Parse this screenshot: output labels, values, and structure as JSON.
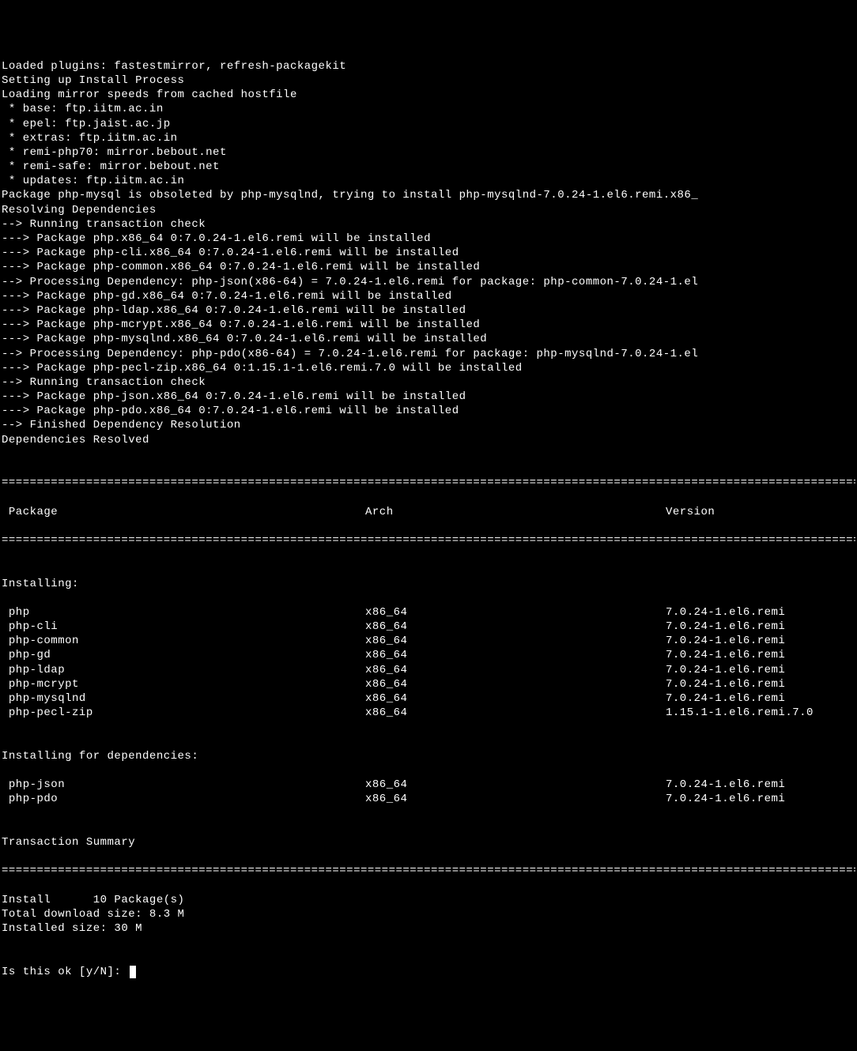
{
  "preamble": [
    "Loaded plugins: fastestmirror, refresh-packagekit",
    "Setting up Install Process",
    "Loading mirror speeds from cached hostfile",
    " * base: ftp.iitm.ac.in",
    " * epel: ftp.jaist.ac.jp",
    " * extras: ftp.iitm.ac.in",
    " * remi-php70: mirror.bebout.net",
    " * remi-safe: mirror.bebout.net",
    " * updates: ftp.iitm.ac.in",
    "Package php-mysql is obsoleted by php-mysqlnd, trying to install php-mysqlnd-7.0.24-1.el6.remi.x86_",
    "Resolving Dependencies",
    "--> Running transaction check",
    "---> Package php.x86_64 0:7.0.24-1.el6.remi will be installed",
    "---> Package php-cli.x86_64 0:7.0.24-1.el6.remi will be installed",
    "---> Package php-common.x86_64 0:7.0.24-1.el6.remi will be installed",
    "--> Processing Dependency: php-json(x86-64) = 7.0.24-1.el6.remi for package: php-common-7.0.24-1.el",
    "---> Package php-gd.x86_64 0:7.0.24-1.el6.remi will be installed",
    "---> Package php-ldap.x86_64 0:7.0.24-1.el6.remi will be installed",
    "---> Package php-mcrypt.x86_64 0:7.0.24-1.el6.remi will be installed",
    "---> Package php-mysqlnd.x86_64 0:7.0.24-1.el6.remi will be installed",
    "--> Processing Dependency: php-pdo(x86-64) = 7.0.24-1.el6.remi for package: php-mysqlnd-7.0.24-1.el",
    "---> Package php-pecl-zip.x86_64 0:1.15.1-1.el6.remi.7.0 will be installed",
    "--> Running transaction check",
    "---> Package php-json.x86_64 0:7.0.24-1.el6.remi will be installed",
    "---> Package php-pdo.x86_64 0:7.0.24-1.el6.remi will be installed",
    "--> Finished Dependency Resolution",
    "",
    "Dependencies Resolved",
    ""
  ],
  "separator": "====================================================================================================================================",
  "header": {
    "package": " Package",
    "arch": "Arch",
    "version": "Version"
  },
  "installing_label": "Installing:",
  "installing": [
    {
      "pkg": " php",
      "arch": "x86_64",
      "ver": "7.0.24-1.el6.remi"
    },
    {
      "pkg": " php-cli",
      "arch": "x86_64",
      "ver": "7.0.24-1.el6.remi"
    },
    {
      "pkg": " php-common",
      "arch": "x86_64",
      "ver": "7.0.24-1.el6.remi"
    },
    {
      "pkg": " php-gd",
      "arch": "x86_64",
      "ver": "7.0.24-1.el6.remi"
    },
    {
      "pkg": " php-ldap",
      "arch": "x86_64",
      "ver": "7.0.24-1.el6.remi"
    },
    {
      "pkg": " php-mcrypt",
      "arch": "x86_64",
      "ver": "7.0.24-1.el6.remi"
    },
    {
      "pkg": " php-mysqlnd",
      "arch": "x86_64",
      "ver": "7.0.24-1.el6.remi"
    },
    {
      "pkg": " php-pecl-zip",
      "arch": "x86_64",
      "ver": "1.15.1-1.el6.remi.7.0"
    }
  ],
  "installing_deps_label": "Installing for dependencies:",
  "installing_deps": [
    {
      "pkg": " php-json",
      "arch": "x86_64",
      "ver": "7.0.24-1.el6.remi"
    },
    {
      "pkg": " php-pdo",
      "arch": "x86_64",
      "ver": "7.0.24-1.el6.remi"
    }
  ],
  "summary": [
    "",
    "Transaction Summary"
  ],
  "summary2": [
    "Install      10 Package(s)",
    "",
    "Total download size: 8.3 M",
    "Installed size: 30 M"
  ],
  "prompt": "Is this ok [y/N]: "
}
